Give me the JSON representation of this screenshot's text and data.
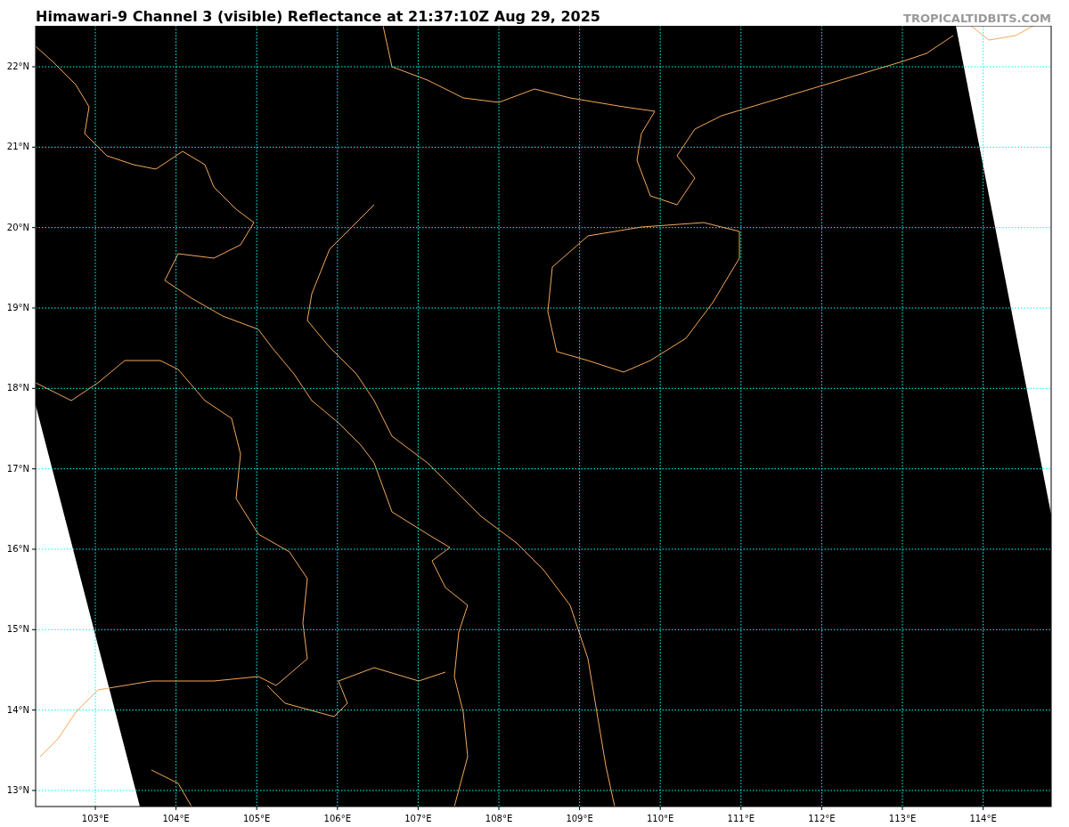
{
  "title": "Himawari-9 Channel 3 (visible) Reflectance at 21:37:10Z Aug 29, 2025",
  "credit": "TROPICALTIDBITS.COM",
  "map": {
    "lat_labels": [
      "22°N",
      "21°N",
      "20°N",
      "19°N",
      "18°N",
      "17°N",
      "16°N",
      "15°N",
      "14°N",
      "13°N"
    ],
    "lon_labels": [
      "103°E",
      "104°E",
      "105°E",
      "106°E",
      "107°E",
      "108°E",
      "109°E",
      "110°E",
      "111°E",
      "112°E",
      "113°E",
      "114°E"
    ]
  }
}
